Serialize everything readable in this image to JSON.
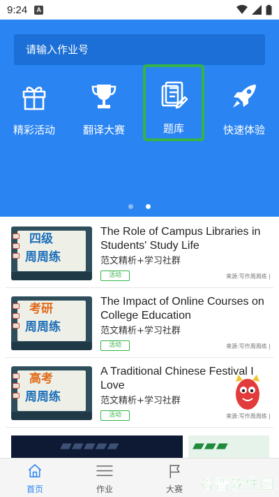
{
  "status_bar": {
    "time": "9:24",
    "badge": "A"
  },
  "search": {
    "placeholder": "请输入作业号"
  },
  "features": [
    {
      "label": "精彩活动",
      "icon": "gift-icon"
    },
    {
      "label": "翻译大赛",
      "icon": "trophy-icon"
    },
    {
      "label": "题库",
      "icon": "question-bank-icon"
    },
    {
      "label": "快速体验",
      "icon": "rocket-icon"
    }
  ],
  "carousel": {
    "count": 2,
    "active": 2
  },
  "articles": [
    {
      "thumb_line1": "四级",
      "thumb_line2": "周周练",
      "title": "The Role of Campus Libraries in Students' Study Life",
      "subtitle": "范文精析+学习社群",
      "tag": "活动",
      "source": "来源:写作周周练 |",
      "line1_color": "#1e6fb8"
    },
    {
      "thumb_line1": "考研",
      "thumb_line2": "周周练",
      "title": "The Impact of Online Courses on College Education",
      "subtitle": "范文精析+学习社群",
      "tag": "活动",
      "source": "来源:写作周周练 |",
      "line1_color": "#e06a1a"
    },
    {
      "thumb_line1": "高考",
      "thumb_line2": "周周练",
      "title": "A Traditional Chinese Festival I Love",
      "subtitle": "范文精析+学习社群",
      "tag": "活动",
      "source": "来源:写作周周练 |",
      "line1_color": "#e06a1a"
    }
  ],
  "tabs": [
    {
      "label": "首页",
      "icon": "home-icon"
    },
    {
      "label": "作业",
      "icon": "menu-icon"
    },
    {
      "label": "大赛",
      "icon": "flag-icon"
    }
  ],
  "watermark": "谷普软件园",
  "colors": {
    "primary": "#2a84f2",
    "search_bg": "#1b6fd6",
    "highlight": "#35b347",
    "tag": "#35b347"
  }
}
